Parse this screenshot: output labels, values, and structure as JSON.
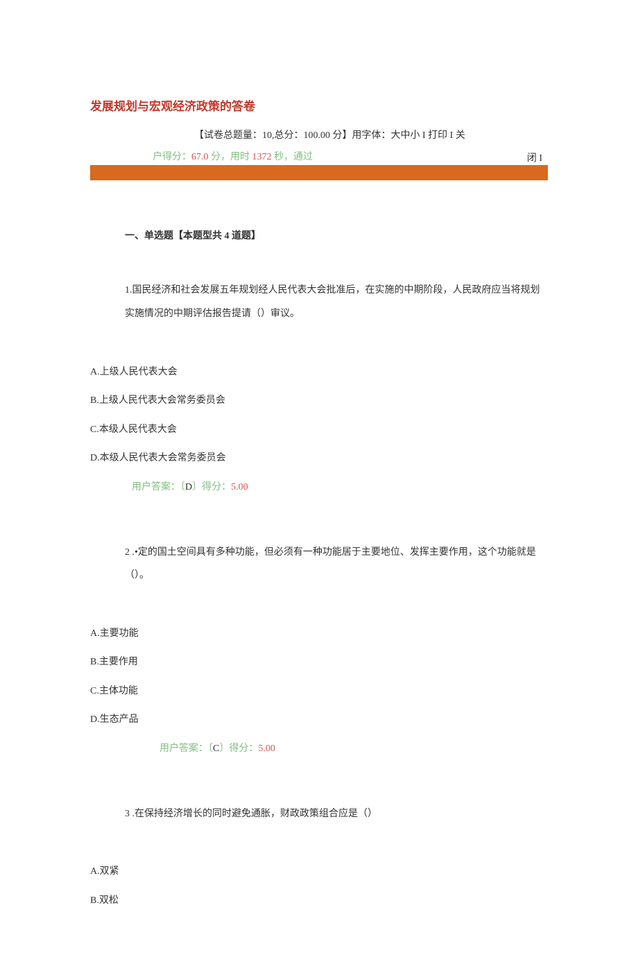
{
  "title": "发展规划与宏观经济政策的答卷",
  "meta": {
    "summary_prefix": "【试卷总题量：",
    "total_questions": "10",
    "comma": ",总分：",
    "total_score": "100.00",
    "score_unit": " 分】",
    "font_label": "用字体：大中小 I 打印 I 关"
  },
  "score_line": {
    "prefix": "户得分：",
    "score": "67.0",
    "score_suffix": " 分，",
    "time_prefix": "用时 ",
    "time": "1372",
    "time_suffix": " 秒，通过",
    "close": "闭 I"
  },
  "section1": {
    "header": "一、单选题【本题型共 4 道题】"
  },
  "q1": {
    "text": "1.国民经济和社会发展五年规划经人民代表大会批准后，在实施的中期阶段，人民政府应当将规划实施情况的中期评估报告提请（）审议。",
    "optA": "A.上级人民代表大会",
    "optB": "B.上级人民代表大会常务委员会",
    "optC": "C.本级人民代表大会",
    "optD": "D.本级人民代表大会常务委员会",
    "ans_prefix": "用户答案：〔",
    "ans_letter": "D",
    "ans_mid": "〕得分：",
    "ans_score": "5.00"
  },
  "q2": {
    "num": "2",
    "text": " .•定的国土空间具有多种功能，但必须有一种功能居于主要地位、发挥主要作用，这个功能就是（）。",
    "optA": "A.主要功能",
    "optB": "B.主要作用",
    "optC": "C.主体功能",
    "optD": "D.生态产品",
    "ans_prefix": "用户答案：〔",
    "ans_letter": "C",
    "ans_mid": "〕得分：",
    "ans_score": "5.00"
  },
  "q3": {
    "num": "3",
    "text": "     .在保持经济增长的同时避免通胀，财政政策组合应是（）",
    "optA": "A.双紧",
    "optB": "B.双松"
  }
}
